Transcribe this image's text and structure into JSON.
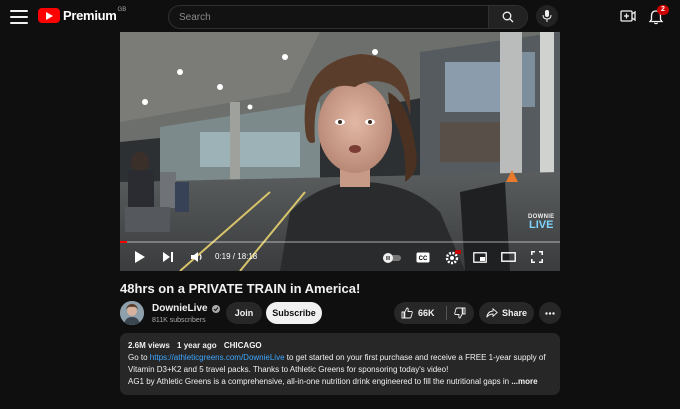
{
  "header": {
    "logo_text": "Premium",
    "logo_region": "GB",
    "search_placeholder": "Search",
    "notification_count": "2"
  },
  "player": {
    "time_display": "0:19 / 18:18",
    "progress_fraction": 0.017,
    "watermark_top": "DOWNIE",
    "watermark_bottom": "LIVE"
  },
  "video": {
    "title": "48hrs on a PRIVATE TRAIN in America!"
  },
  "channel": {
    "name": "DownieLive",
    "subscribers": "811K subscribers",
    "join_label": "Join",
    "subscribe_label": "Subscribe"
  },
  "actions": {
    "like_count": "66K",
    "share_label": "Share"
  },
  "description": {
    "views": "2.6M views",
    "age": "1 year ago",
    "location": "CHICAGO",
    "line1_pre": "Go to ",
    "line1_link": "https://athleticgreens.com/DownieLive",
    "line1_post": " to get started on your first purchase and receive a FREE 1-year supply of",
    "line2": "Vitamin D3+K2 and 5 travel packs. Thanks to Athletic Greens for sponsoring today's video!",
    "line3": "AG1 by Athletic Greens is a comprehensive, all-in-one nutrition drink engineered to fill the nutritional gaps in ",
    "more_label": "...more"
  },
  "colors": {
    "background": "#0f0f0f",
    "brand_red": "#ff0000",
    "link": "#3ea6ff",
    "chip": "#272727"
  },
  "icons": [
    "hamburger-icon",
    "youtube-logo-icon",
    "search-icon",
    "mic-icon",
    "create-icon",
    "bell-icon",
    "play-icon",
    "next-icon",
    "volume-icon",
    "autoplay-toggle-icon",
    "captions-icon",
    "settings-icon",
    "miniplayer-icon",
    "theater-icon",
    "fullscreen-icon",
    "verified-icon",
    "like-icon",
    "dislike-icon",
    "share-icon",
    "more-icon"
  ]
}
